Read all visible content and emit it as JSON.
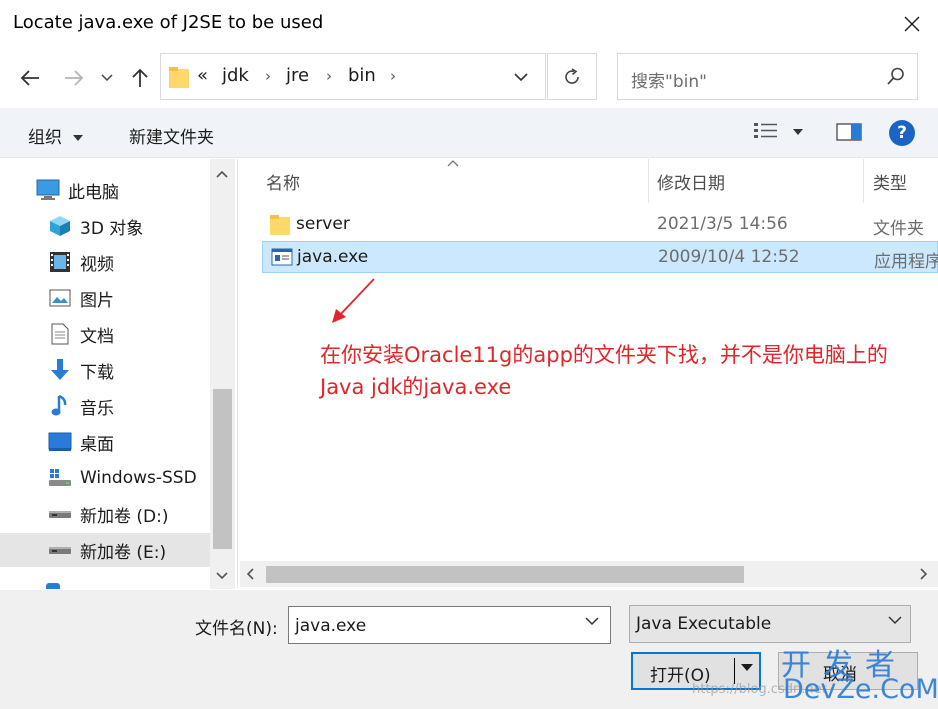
{
  "window": {
    "title": "Locate java.exe of J2SE to be used"
  },
  "address": {
    "prefix": "«",
    "crumbs": [
      "jdk",
      "jre",
      "bin"
    ]
  },
  "search": {
    "placeholder": "搜索\"bin\""
  },
  "toolbar": {
    "organize": "组织",
    "new_folder": "新建文件夹"
  },
  "sidebar": {
    "items": [
      {
        "label": "此电脑",
        "icon": "computer-icon"
      },
      {
        "label": "3D 对象",
        "icon": "cube-icon"
      },
      {
        "label": "视频",
        "icon": "video-icon"
      },
      {
        "label": "图片",
        "icon": "picture-icon"
      },
      {
        "label": "文档",
        "icon": "document-icon"
      },
      {
        "label": "下载",
        "icon": "download-icon"
      },
      {
        "label": "音乐",
        "icon": "music-icon"
      },
      {
        "label": "桌面",
        "icon": "desktop-icon"
      },
      {
        "label": "Windows-SSD",
        "icon": "drive-icon"
      },
      {
        "label": "新加卷 (D:)",
        "icon": "drive-icon"
      },
      {
        "label": "新加卷 (E:)",
        "icon": "drive-icon",
        "selected": true
      }
    ]
  },
  "list": {
    "columns": {
      "name": "名称",
      "date": "修改日期",
      "type": "类型"
    },
    "rows": [
      {
        "name": "server",
        "date": "2021/3/5 14:56",
        "type": "文件夹",
        "icon": "folder-icon"
      },
      {
        "name": "java.exe",
        "date": "2009/10/4 12:52",
        "type": "应用程序",
        "icon": "exe-icon",
        "selected": true
      }
    ]
  },
  "annotation": {
    "text": "在你安装Oracle11g的app的文件夹下找，并不是你电脑上的Java jdk的java.exe",
    "color": "#e0262a"
  },
  "bottom": {
    "filename_label": "文件名(N):",
    "filename_value": "java.exe",
    "filter_value": "Java Executable",
    "open_label": "打开(O)",
    "cancel_label": "取消"
  },
  "watermark": {
    "cn": "开发者",
    "en": "DevZe.CoM",
    "url": "https://blog.csdn.net"
  },
  "colors": {
    "accent": "#0078d7",
    "selection": "#cce8ff",
    "help": "#1c64c4"
  }
}
